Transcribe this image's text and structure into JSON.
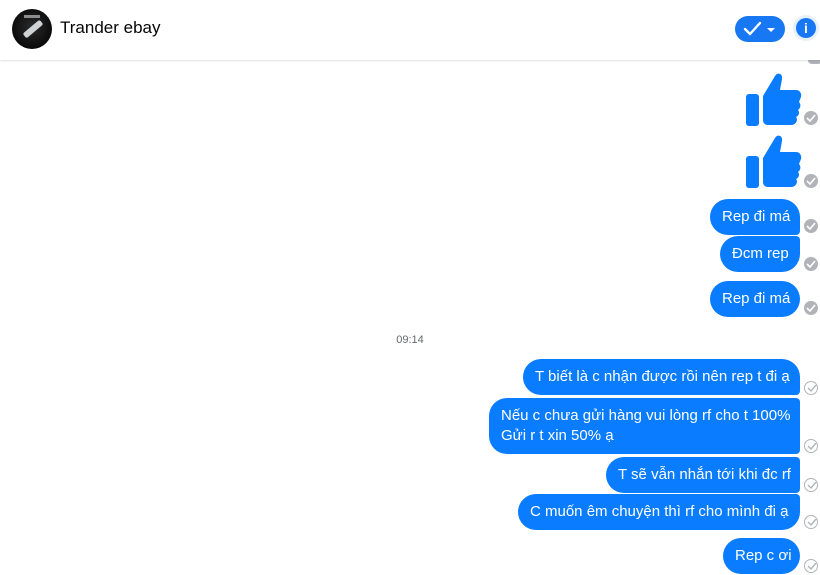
{
  "header": {
    "contact_name": "Trander ebay",
    "accent_color": "#1877f2",
    "check_icon": "checkmark-icon",
    "dropdown_icon": "caret-down-icon",
    "info_icon": "info-icon",
    "info_symbol": "i"
  },
  "conversation": {
    "timestamp": "09:14",
    "messages": [
      {
        "type": "thumbs-up",
        "status": "seen"
      },
      {
        "type": "thumbs-up",
        "status": "seen"
      },
      {
        "type": "text",
        "text": "Rep đi má",
        "status": "seen"
      },
      {
        "type": "text",
        "text": "Đcm rep",
        "status": "seen"
      },
      {
        "type": "text",
        "text": "Rep đi má",
        "status": "seen"
      },
      {
        "type": "text",
        "text": "T biết là c nhận được rồi nên rep t đi ạ",
        "status": "sent"
      },
      {
        "type": "text",
        "lines": [
          "Nếu c chưa gửi hàng vui lòng rf cho t 100%",
          "Gửi r t xin 50% ạ"
        ],
        "status": "sent"
      },
      {
        "type": "text",
        "text": "T sẽ vẫn nhắn tới khi đc rf",
        "status": "sent"
      },
      {
        "type": "text",
        "text": "C muốn êm chuyện thì rf cho mình đi ạ",
        "status": "sent"
      },
      {
        "type": "text",
        "text": "Rep c ơi",
        "status": "sent"
      }
    ]
  }
}
